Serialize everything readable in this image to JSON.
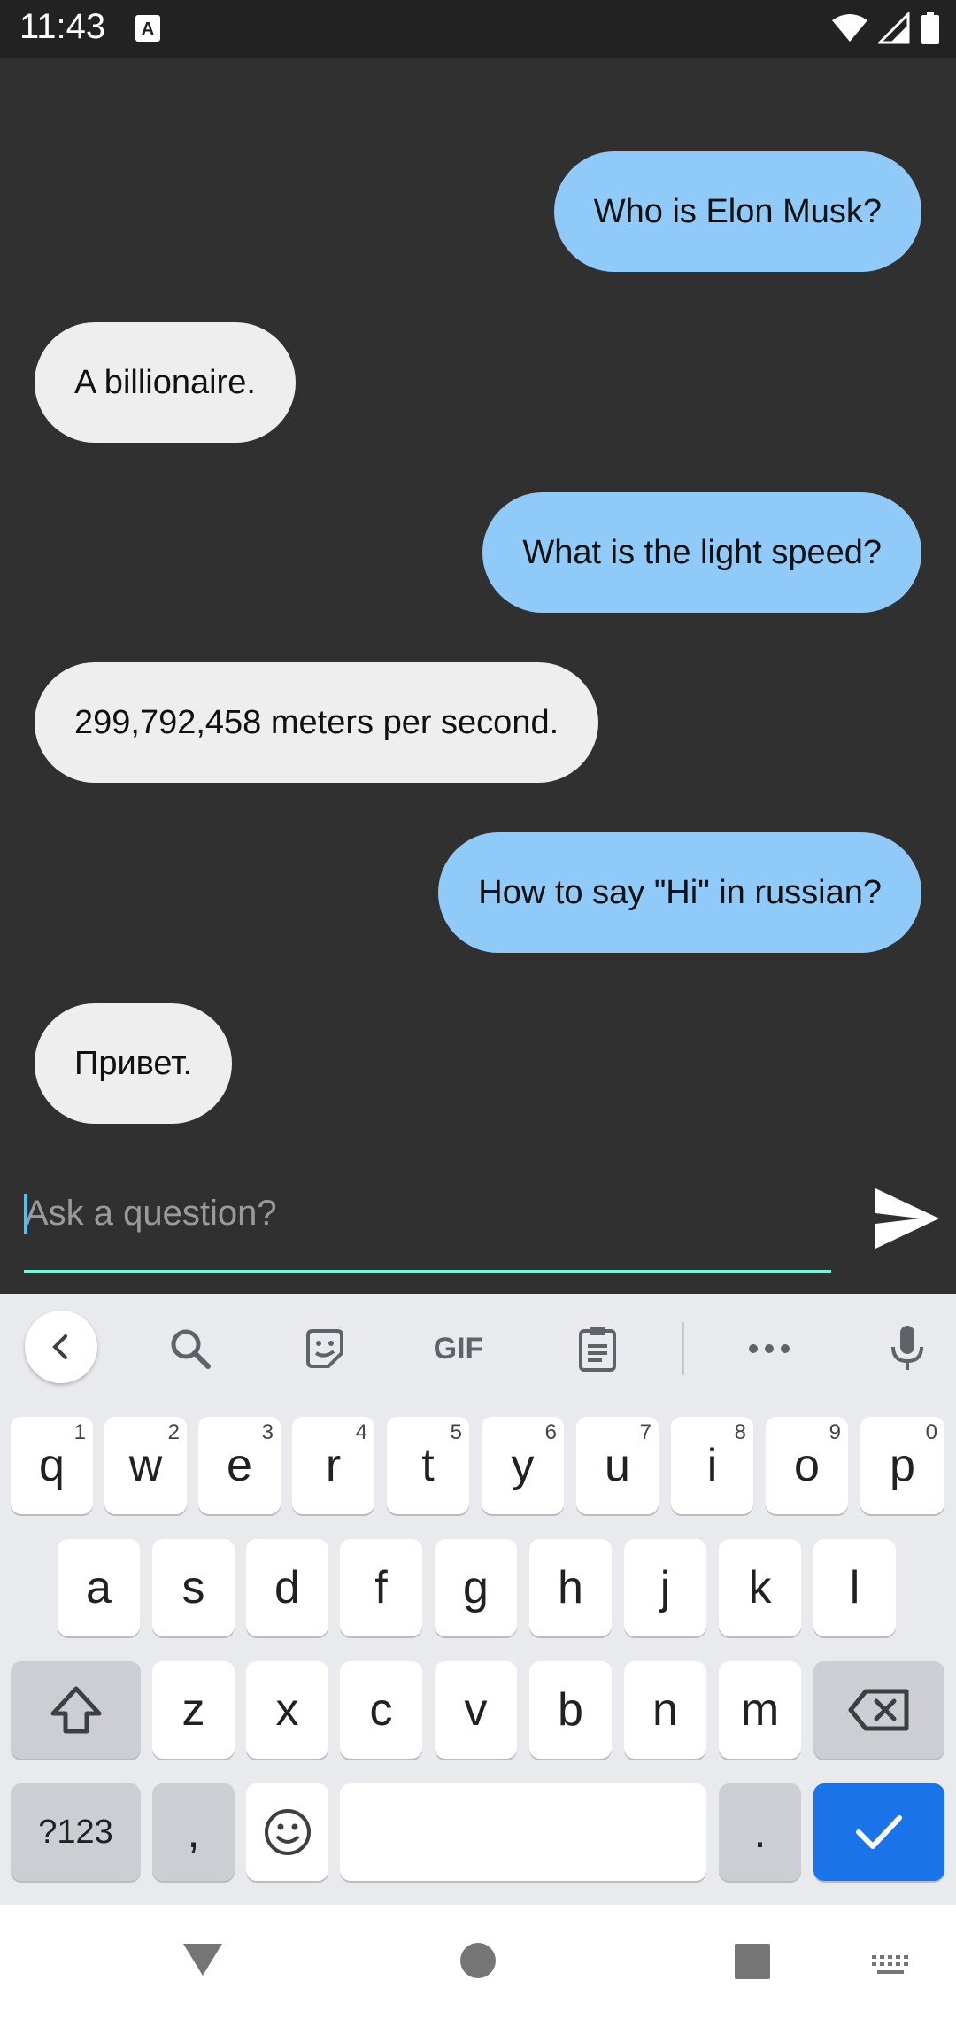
{
  "status_bar": {
    "time": "11:43",
    "notification_icon": "autofill-a-icon",
    "icons": [
      "wifi-icon",
      "signal-icon",
      "battery-icon"
    ]
  },
  "chat": {
    "messages": [
      {
        "sender": "user",
        "text": "Who is Elon Musk?"
      },
      {
        "sender": "bot",
        "text": "A billionaire."
      },
      {
        "sender": "user",
        "text": "What is the light speed?"
      },
      {
        "sender": "bot",
        "text": "299,792,458 meters per second."
      },
      {
        "sender": "user",
        "text": "How to say \"Hi\" in russian?"
      },
      {
        "sender": "bot",
        "text": "Привет."
      }
    ]
  },
  "input": {
    "placeholder": "Ask a question?",
    "value": "",
    "send_icon": "send-icon"
  },
  "keyboard": {
    "toolbar": [
      "back-icon",
      "search-icon",
      "sticker-icon",
      "GIF",
      "clipboard-icon",
      "more-icon",
      "mic-icon"
    ],
    "row1": [
      {
        "key": "q",
        "hint": "1"
      },
      {
        "key": "w",
        "hint": "2"
      },
      {
        "key": "e",
        "hint": "3"
      },
      {
        "key": "r",
        "hint": "4"
      },
      {
        "key": "t",
        "hint": "5"
      },
      {
        "key": "y",
        "hint": "6"
      },
      {
        "key": "u",
        "hint": "7"
      },
      {
        "key": "i",
        "hint": "8"
      },
      {
        "key": "o",
        "hint": "9"
      },
      {
        "key": "p",
        "hint": "0"
      }
    ],
    "row2": [
      "a",
      "s",
      "d",
      "f",
      "g",
      "h",
      "j",
      "k",
      "l"
    ],
    "row3": [
      "z",
      "x",
      "c",
      "v",
      "b",
      "n",
      "m"
    ],
    "row4": {
      "symbols": "?123",
      "comma": ",",
      "period": "."
    },
    "colors": {
      "accent": "#1A73E8",
      "key": "#FFFFFF",
      "key_special": "#CCCED3",
      "background": "#E8EAED"
    }
  },
  "nav_bar": {
    "icons": [
      "back-triangle-icon",
      "home-circle-icon",
      "recents-square-icon",
      "keyboard-switch-icon"
    ]
  },
  "colors": {
    "user_bubble": "#90CAF9",
    "bot_bubble": "#EEEEEE",
    "chat_background": "#303030",
    "input_underline": "#64FFDA"
  }
}
